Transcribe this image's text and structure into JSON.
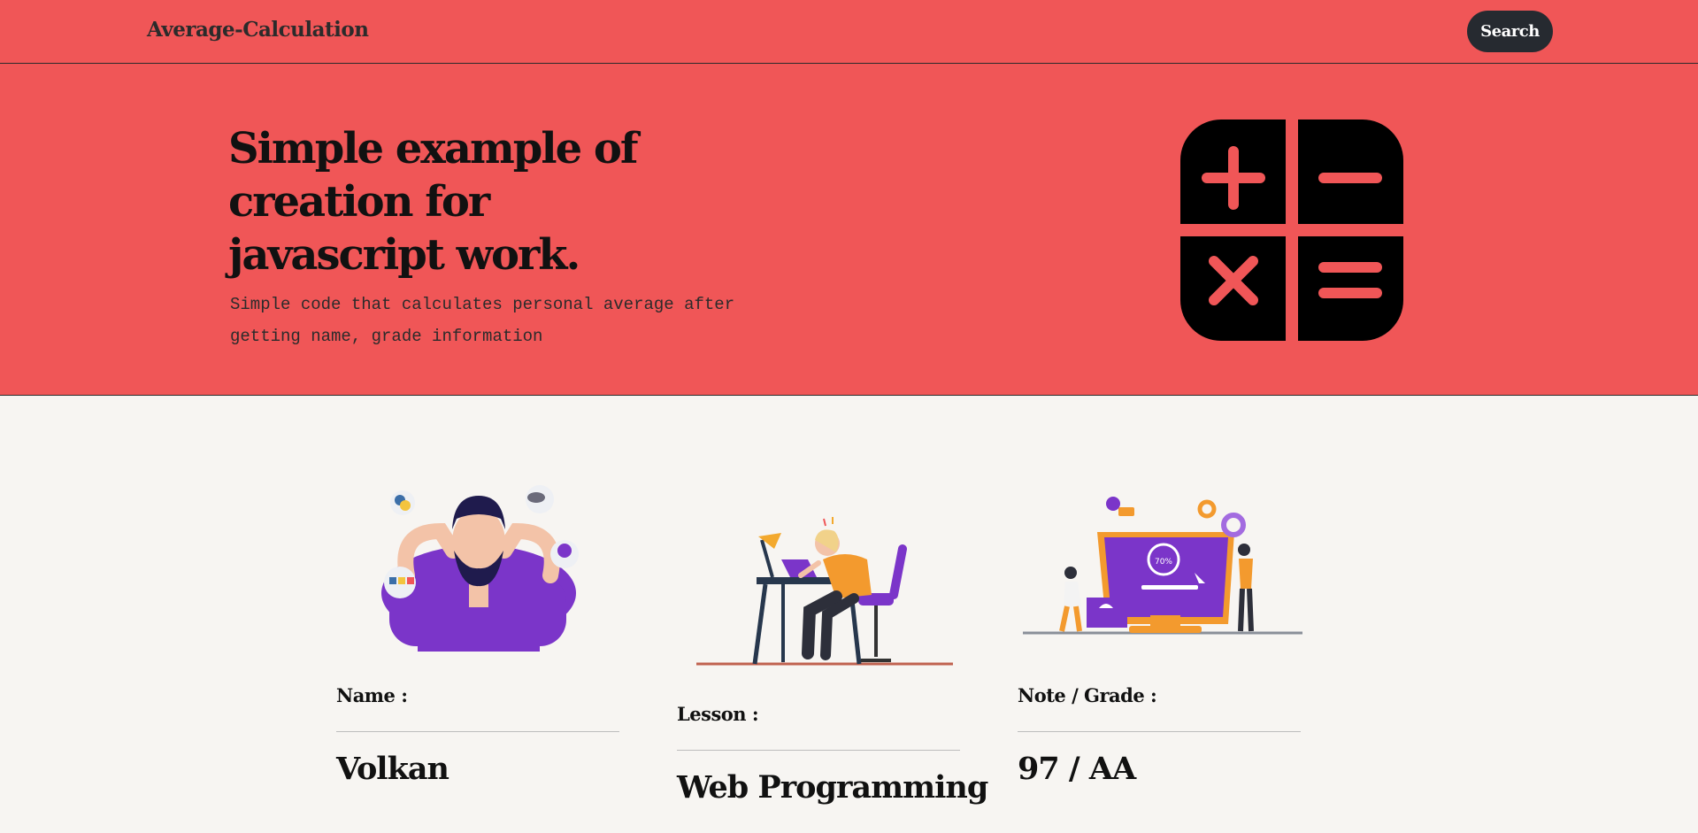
{
  "navbar": {
    "brand": "Average-Calculation",
    "search_label": "Search"
  },
  "hero": {
    "title_lines": [
      "Simple example of",
      "creation for",
      "javascript work."
    ],
    "subtitle_lines": [
      "Simple code that calculates personal average after",
      "getting name, grade information"
    ],
    "icon": "calculator-icon"
  },
  "cards": [
    {
      "label": "Name :",
      "value": "Volkan",
      "illustration": "stressed-developer-illustration"
    },
    {
      "label": "Lesson :",
      "value": "Web Programming",
      "illustration": "tired-student-desk-illustration"
    },
    {
      "label": "Note / Grade :",
      "value": "97 / AA",
      "illustration": "progress-monitor-illustration",
      "illustration_text": "70%"
    }
  ],
  "colors": {
    "primary": "#f05657",
    "dark": "#262a30",
    "background": "#f7f5f2",
    "accent_purple": "#7b35c9",
    "accent_orange": "#f39a2e"
  }
}
